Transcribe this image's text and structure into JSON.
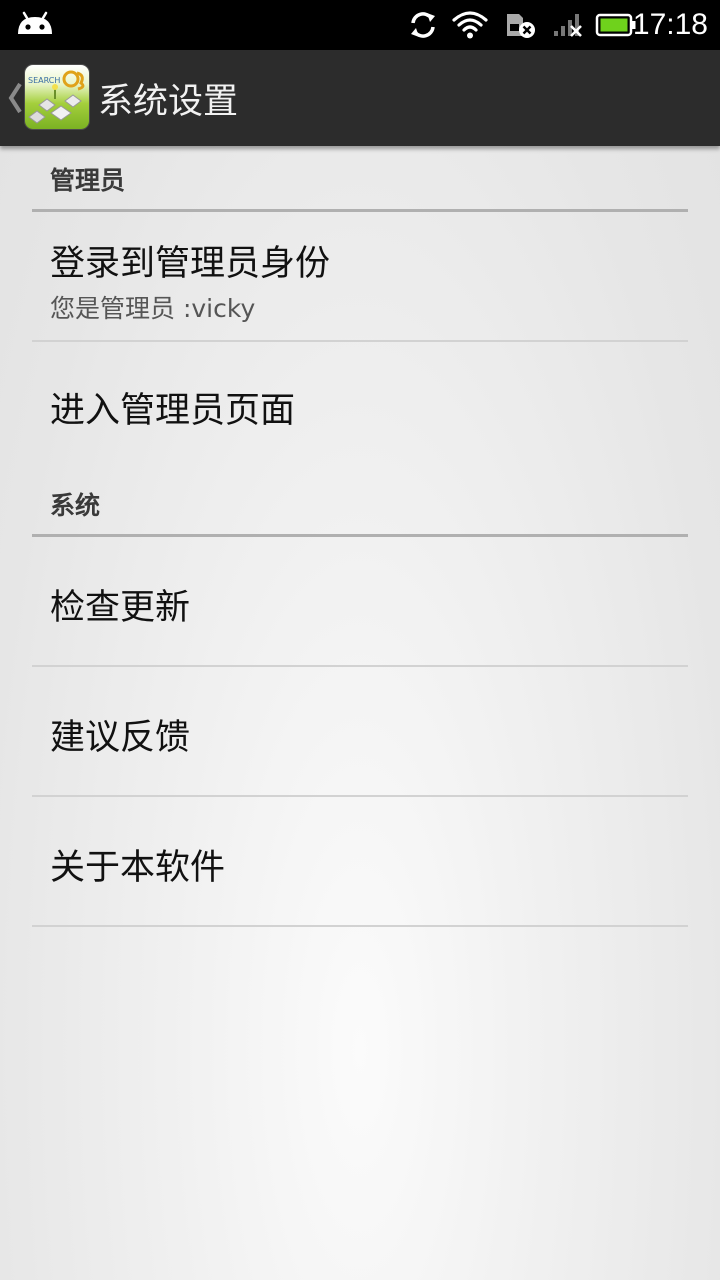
{
  "status_bar": {
    "time": "17:18",
    "icons": [
      "android-icon",
      "sync-icon",
      "wifi-icon",
      "sim-error-icon",
      "signal-none-icon",
      "battery-full-icon"
    ],
    "battery_color": "#6fd21c"
  },
  "action_bar": {
    "title": "系统设置",
    "app_icon": "app-logo-icon",
    "app_icon_text": "SEARCH",
    "back": "chevron-left-icon",
    "background": "#2c2c2c"
  },
  "sections": [
    {
      "header": "管理员",
      "items": [
        {
          "title": "登录到管理员身份",
          "summary": "您是管理员 :vicky"
        },
        {
          "title": "进入管理员页面"
        }
      ]
    },
    {
      "header": "系统",
      "items": [
        {
          "title": "检查更新"
        },
        {
          "title": "建议反馈"
        },
        {
          "title": "关于本软件"
        }
      ]
    }
  ]
}
